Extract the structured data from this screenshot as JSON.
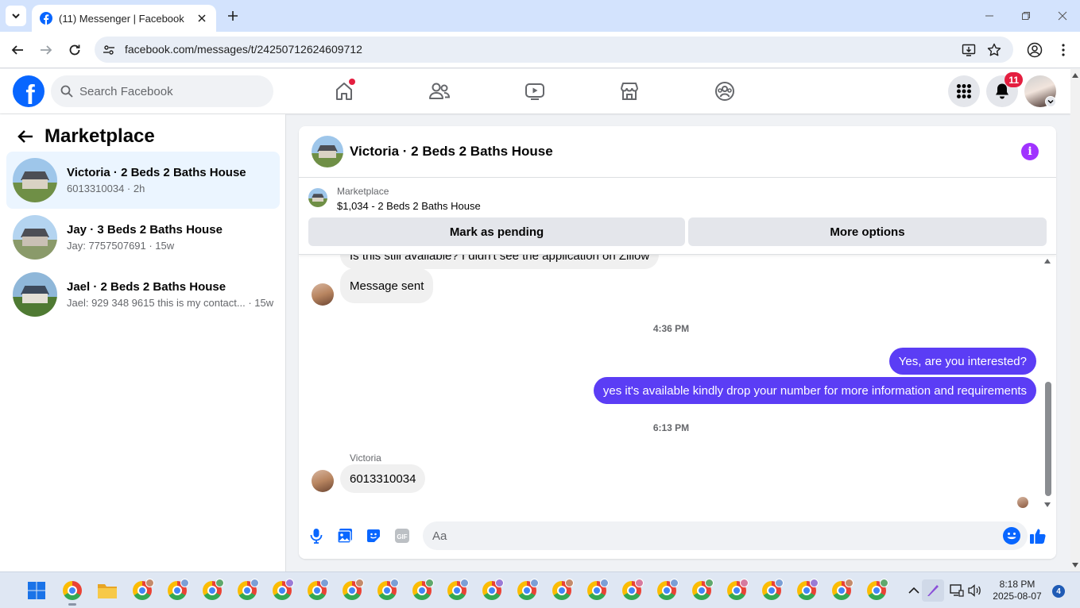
{
  "browser": {
    "tab_title": "(11) Messenger | Facebook",
    "url": "facebook.com/messages/t/24250712624609712"
  },
  "header": {
    "search_placeholder": "Search Facebook",
    "notifications_count": "11",
    "brand_color": "#0866ff"
  },
  "left_panel": {
    "title": "Marketplace",
    "conversations": [
      {
        "name": "Victoria · 2 Beds 2 Baths House",
        "preview": "6013310034 · 2h",
        "active": true
      },
      {
        "name": "Jay · 3 Beds 2 Baths House",
        "preview": "Jay: 7757507691 · 15w",
        "active": false
      },
      {
        "name": "Jael · 2 Beds 2 Baths House",
        "preview": "Jael: 929 348 9615 this is my contact... · 15w",
        "active": false
      }
    ]
  },
  "chat": {
    "title": "Victoria · 2 Beds 2 Baths House",
    "listing_category": "Marketplace",
    "listing_price": "$1,034 - 2 Beds 2 Baths House",
    "mark_pending_label": "Mark as pending",
    "more_options_label": "More options",
    "messages": {
      "partial_in": "Is this still available? I didn't see the application on Zillow",
      "sent_in": "Message sent",
      "time_1": "4:36 PM",
      "out_1": "Yes, are you interested?",
      "out_2": "yes it's available kindly drop your number for more information and requirements",
      "time_2": "6:13 PM",
      "sender_name": "Victoria",
      "in_last": "6013310034"
    },
    "composer_placeholder": "Aa",
    "outgoing_color": "#5b3df5"
  },
  "taskbar": {
    "time": "8:18 PM",
    "date": "2025-08-07",
    "notification_count": "4"
  }
}
